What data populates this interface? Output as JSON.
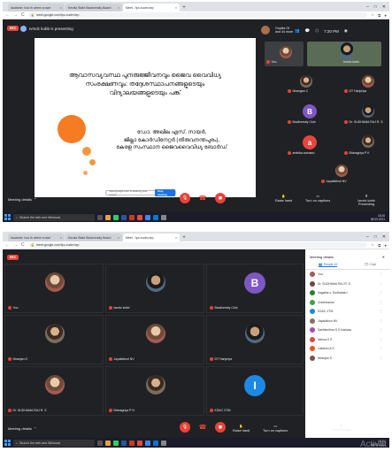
{
  "browser": {
    "tabs": [
      "kaufonte: hou th ahem cruwe",
      "Kerala State Biodiversity Board",
      "Meet - fpo-xudm-tep"
    ],
    "url": "meet.google.com/fpo-xudm-tep",
    "tab_close": "×",
    "tab_new": "+",
    "nav_back": "←",
    "nav_fwd": "→",
    "nav_reload": "C",
    "lock": "🔒"
  },
  "taskbar": {
    "search_placeholder": "Search the web and Windows",
    "time": "18:20",
    "date": "08-09-2021"
  },
  "s1": {
    "rec": "REC",
    "presenter": "Ivmdc kobb is presenting",
    "clock": "7:20 PM",
    "gopika": "Gopika Gf",
    "others": "and 44 more",
    "slide": {
      "title_lines": [
        "ആവാസവ്യവസ്ഥ പുനരുജ്ജീവനവും ജൈവ വൈവിധ്യ",
        "സംരക്ഷണവും: തദ്ദേശസ്ഥാപനങ്ങളുടെയും",
        "വിദ്യാലയങ്ങളുടെയും പങ്ക്"
      ],
      "author_lines": [
        "ഡോ. അഖില എസ്. നായർ,",
        "ജില്ലാ കോർഡിനേറ്റർ (തിരുവനന്തപുരം),",
        "കേരള സംസ്ഥാന ജൈവവൈവിധ്യ ബോർഡ്"
      ],
      "share_bar": "meet.google.com is sharing your screen",
      "stop_label": "Stop sharing"
    },
    "participants": [
      {
        "name": "You"
      },
      {
        "name": "Ismdc kobb"
      },
      {
        "name": "Nirangan C"
      },
      {
        "name": "DT Haripriya"
      },
      {
        "name": "Biodiversity Club",
        "initial": "B"
      },
      {
        "name": "Dr. SUDHAMA RAJ R. S"
      },
      {
        "name": "ambika aumanu",
        "initial": "a"
      },
      {
        "name": "Bhinagriya P K"
      },
      {
        "name": "Jayakkikrol NV"
      }
    ],
    "meeting_details": "Meeting details",
    "raise_hand": "Raise hand",
    "captions": "Turn on captions",
    "present_label": "Ismdc kobb Presenting"
  },
  "s2": {
    "rec": "REC",
    "tiles": [
      {
        "name": "You"
      },
      {
        "name": "Ismdc kobb"
      },
      {
        "name": "Biodiversity Club",
        "initial": "B"
      },
      {
        "name": "Niranjan S"
      },
      {
        "name": "Jayakkikrol NV"
      },
      {
        "name": "DT Haripriya"
      },
      {
        "name": "Dr. SUDHAMA RAJ R. S"
      },
      {
        "name": "Bhinagriya P N"
      },
      {
        "name": "KSAC VTM",
        "initial": "I"
      }
    ],
    "meeting_details": "Meeting details",
    "raise_hand": "Raise hand",
    "captions": "Turn on captions",
    "present_now": "Present now",
    "panel": {
      "title": "Meeting details",
      "tab_people": "People",
      "tab_chat": "Chat",
      "people_count": "49",
      "rows": [
        "You",
        "Dr. SUDHAMA RAJ R. S",
        "Vagatha s. Sudhaharu",
        "Greenhands",
        "KSAC VTM",
        "Jayakkikrol NV",
        "Sakthimithra S S Karilara",
        "Nenna K S",
        "Lakshmi A S",
        "Niranjan S"
      ],
      "row_actions": "⋮"
    },
    "watermark": "Activat"
  },
  "colors": {
    "meet_bg": "#202124",
    "accent_red": "#ea4335",
    "slide_orange": "#f57c22",
    "avatar_purple": "#7e57c2",
    "avatar_blue": "#1e88e5",
    "avatar_red": "#e8453c"
  }
}
